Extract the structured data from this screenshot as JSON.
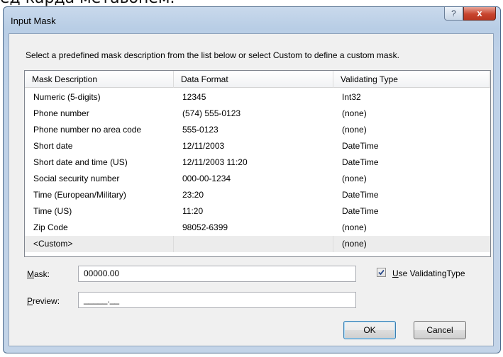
{
  "background_text": "ед карда метавонем.",
  "dialog": {
    "title": "Input Mask",
    "help_glyph": "?",
    "close_glyph": "x",
    "instructions": "Select a predefined mask description from the list below or select Custom to define a custom mask."
  },
  "list": {
    "columns": [
      "Mask Description",
      "Data Format",
      "Validating Type"
    ],
    "rows": [
      [
        "Numeric (5-digits)",
        "12345",
        "Int32"
      ],
      [
        "Phone number",
        "(574) 555-0123",
        "(none)"
      ],
      [
        "Phone number no area code",
        "555-0123",
        "(none)"
      ],
      [
        "Short date",
        "12/11/2003",
        "DateTime"
      ],
      [
        "Short date and time (US)",
        "12/11/2003 11:20",
        "DateTime"
      ],
      [
        "Social security number",
        "000-00-1234",
        "(none)"
      ],
      [
        "Time (European/Military)",
        "23:20",
        "DateTime"
      ],
      [
        "Time (US)",
        "11:20",
        "DateTime"
      ],
      [
        "Zip Code",
        "98052-6399",
        "(none)"
      ],
      [
        "<Custom>",
        "",
        "(none)"
      ]
    ],
    "selected_index": 9
  },
  "mask": {
    "label_accel": "M",
    "label_rest": "ask:",
    "value": "00000.00"
  },
  "preview": {
    "label_accel": "P",
    "label_rest": "review:",
    "value": "_____.__"
  },
  "use_validating_type": {
    "accel": "U",
    "rest": "se ValidatingType",
    "checked": true
  },
  "buttons": {
    "ok": "OK",
    "cancel": "Cancel"
  }
}
